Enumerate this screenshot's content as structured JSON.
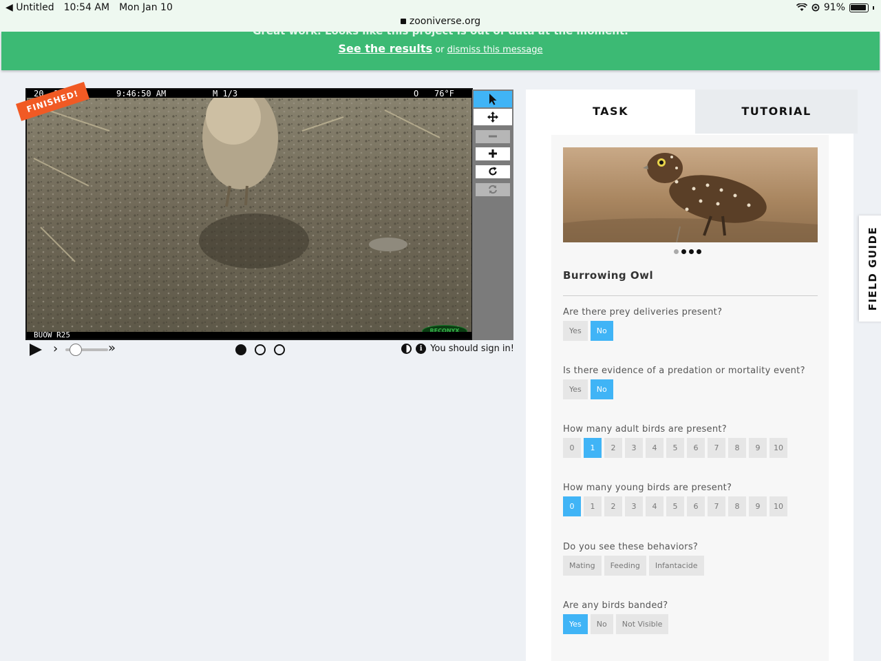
{
  "status_bar": {
    "back_app": "◀ Untitled",
    "time": "10:54 AM",
    "date": "Mon Jan 10",
    "battery": "91%",
    "url": "zooniverse.org"
  },
  "banner": {
    "top_text": "Great work. Looks like this project is out of data at the moment.",
    "see_results": "See the results",
    "or": "or",
    "dismiss": "dismiss this message"
  },
  "viewer": {
    "header_date": "20 -10",
    "header_time": "9:46:50 AM",
    "header_frame": "M 1/3",
    "header_moon": "O",
    "header_temp": "76°F",
    "footer_label": "BUOW R25",
    "camera_brand": "RECONYX",
    "finished": "FINISHED!",
    "sign_in": "You should sign in!"
  },
  "tabs": {
    "task": "TASK",
    "tutorial": "TUTORIAL"
  },
  "task": {
    "species": "Burrowing Owl",
    "questions": [
      {
        "label": "Are there prey deliveries present?",
        "options": [
          "Yes",
          "No"
        ],
        "selected": "No"
      },
      {
        "label": "Is there evidence of a predation or mortality event?",
        "options": [
          "Yes",
          "No"
        ],
        "selected": "No"
      },
      {
        "label": "How many adult birds are present?",
        "options": [
          "0",
          "1",
          "2",
          "3",
          "4",
          "5",
          "6",
          "7",
          "8",
          "9",
          "10"
        ],
        "selected": "1"
      },
      {
        "label": "How many young birds are present?",
        "options": [
          "0",
          "1",
          "2",
          "3",
          "4",
          "5",
          "6",
          "7",
          "8",
          "9",
          "10"
        ],
        "selected": "0"
      },
      {
        "label": "Do you see these behaviors?",
        "options": [
          "Mating",
          "Feeding",
          "Infantacide"
        ],
        "selected": ""
      },
      {
        "label": "Are any birds banded?",
        "options": [
          "Yes",
          "No",
          "Not Visible"
        ],
        "selected": "Yes"
      }
    ]
  },
  "field_guide": "FIELD GUIDE"
}
